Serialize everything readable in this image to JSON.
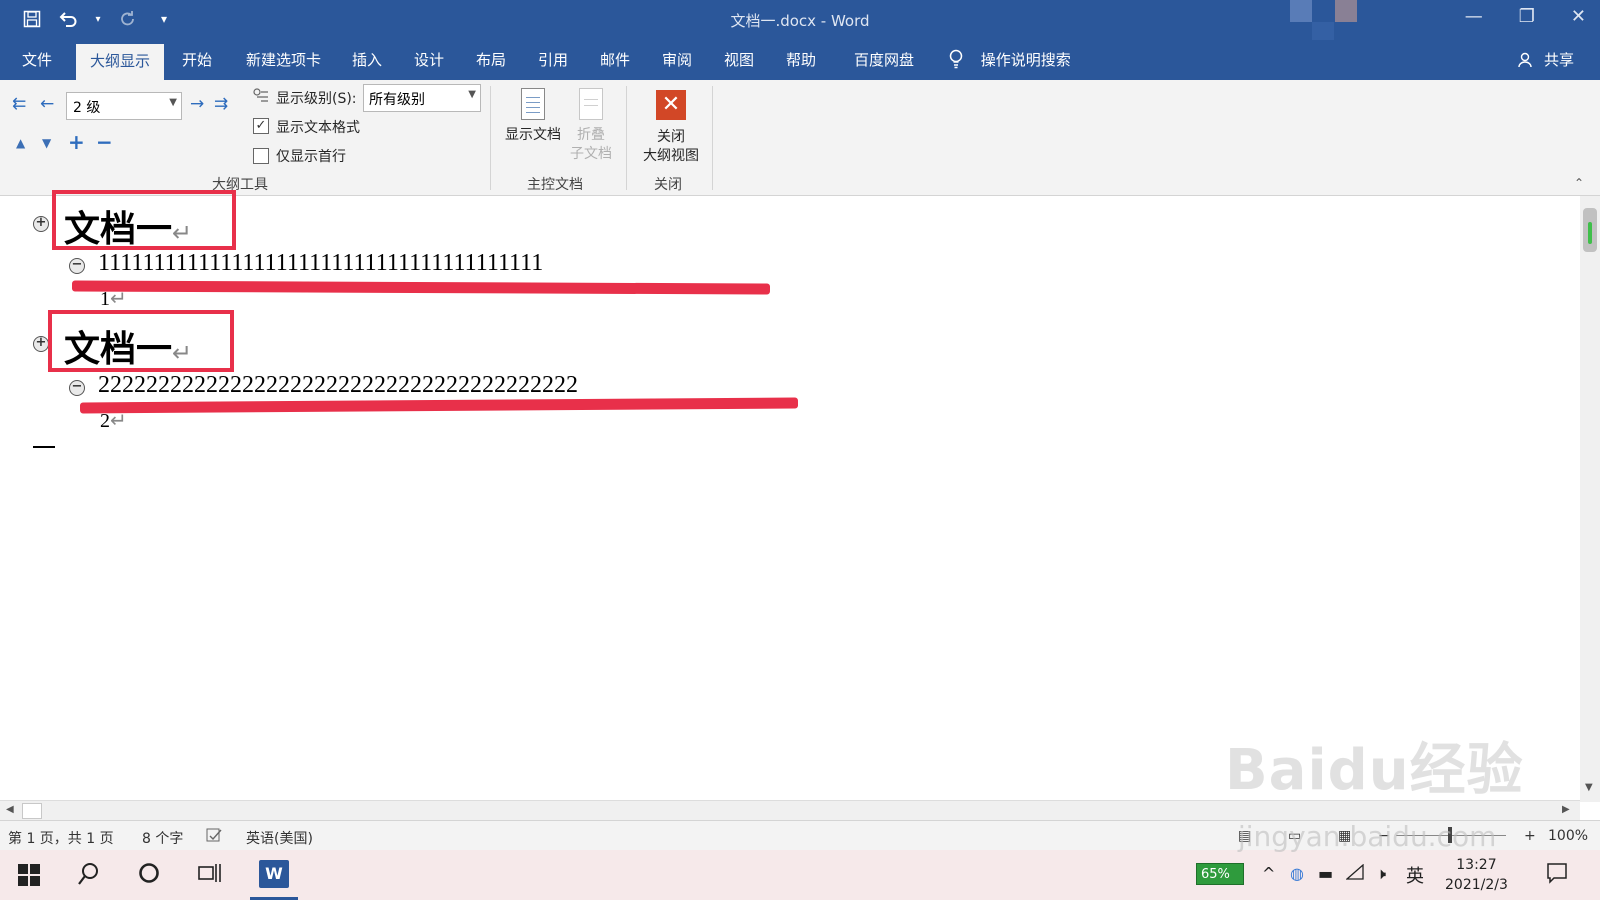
{
  "window": {
    "title": "文档一.docx  -  Word",
    "minimize": "—",
    "restore": "❐",
    "close": "✕"
  },
  "qat": {
    "save_icon": "save-icon",
    "undo_icon": "undo-icon",
    "redo_icon": "redo-icon",
    "customize": "▾"
  },
  "tabs": [
    {
      "label": "文件"
    },
    {
      "label": "大纲显示",
      "active": true
    },
    {
      "label": "开始"
    },
    {
      "label": "新建选项卡"
    },
    {
      "label": "插入"
    },
    {
      "label": "设计"
    },
    {
      "label": "布局"
    },
    {
      "label": "引用"
    },
    {
      "label": "邮件"
    },
    {
      "label": "审阅"
    },
    {
      "label": "视图"
    },
    {
      "label": "帮助"
    },
    {
      "label": "百度网盘"
    }
  ],
  "tell_me": "操作说明搜索",
  "share": "共享",
  "outline_tools": {
    "level_value": "2 级",
    "show_level_label": "显示级别(S):",
    "show_level_value": "所有级别",
    "show_text_format": "显示文本格式",
    "show_text_format_checked": true,
    "show_first_line": "仅显示首行",
    "show_first_line_checked": false,
    "group_label": "大纲工具"
  },
  "master_doc": {
    "show_doc": "显示文档",
    "collapse_sub_1": "折叠",
    "collapse_sub_2": "子文档",
    "group_label": "主控文档"
  },
  "close_group": {
    "close_1": "关闭",
    "close_2": "大纲视图",
    "group_label": "关闭"
  },
  "document": {
    "heading1": "文档一",
    "body1": "1111111111111111111111111111111111111111",
    "body1b": "1",
    "heading2": "文档一",
    "body2": "2222222222222222222222222222222222222222",
    "body2b": "2",
    "return_mark": "↵"
  },
  "status": {
    "page": "第 1 页，共 1 页",
    "words": "8 个字",
    "language": "英语(美国)",
    "zoom": "100%"
  },
  "taskbar": {
    "battery": "65%",
    "ime": "英",
    "time": "13:27",
    "date": "2021/2/3"
  },
  "watermark": {
    "main": "Baidu经验",
    "sub": "jingyan.baidu.com"
  },
  "colors": {
    "brand": "#2b579a",
    "annotation": "#e8304a",
    "close": "#d24726"
  }
}
